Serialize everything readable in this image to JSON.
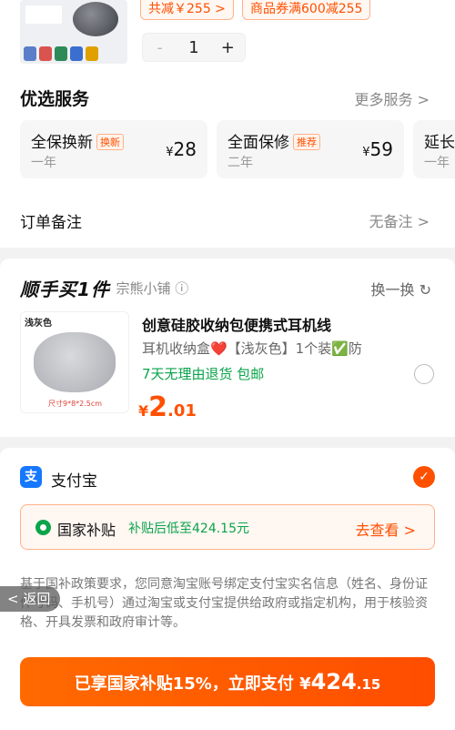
{
  "top_item": {
    "discount_tag": "共减￥255 >",
    "coupon_tag": "商品券满600减255",
    "qty_minus": "-",
    "qty": "1",
    "qty_plus": "+"
  },
  "services": {
    "title": "优选服务",
    "more": "更多服务 >",
    "cards": [
      {
        "name": "全保换新",
        "badge": "换新",
        "term": "一年",
        "currency": "¥",
        "price": "28"
      },
      {
        "name": "全面保修",
        "badge": "推荐",
        "term": "二年",
        "currency": "¥",
        "price": "59"
      },
      {
        "name": "延长",
        "term": "一年"
      }
    ]
  },
  "order_note": {
    "label": "订单备注",
    "value": "无备注 >"
  },
  "second_item": {
    "brand": "顺手买1件",
    "shop": "· 宗熊小铺 ⓘ",
    "swap": "换一换 ↻",
    "img_color_label": "浅灰色",
    "img_size_label": "尺寸9*8*2.5cm",
    "title": "创意硅胶收纳包便携式耳机线",
    "desc": "耳机收纳盒❤️【浅灰色】1个装✅防",
    "returns": "7天无理由退货  包邮",
    "currency": "¥",
    "price_int": "2",
    "price_dec": ".01"
  },
  "payment": {
    "method": "支付宝",
    "subsidy_title": "国家补贴",
    "subsidy_desc": "补贴后低至424.15元",
    "subsidy_go": "去查看 >",
    "notice": "基于国补政策要求，您同意淘宝账号绑定支付宝实名信息（姓名、身份证件号码、手机号）通过淘宝或支付宝提供给政府或指定机构，用于核验资格、开具发票和政府审计等。",
    "back": "< 返回"
  },
  "pay_button": {
    "prefix": "已享国家补贴15%，立即支付 ¥",
    "amount_int": "424",
    "amount_dec": ".15"
  },
  "colors": {
    "accent": "#ff5000",
    "green": "#0aa44a",
    "alipay": "#1677ff"
  }
}
